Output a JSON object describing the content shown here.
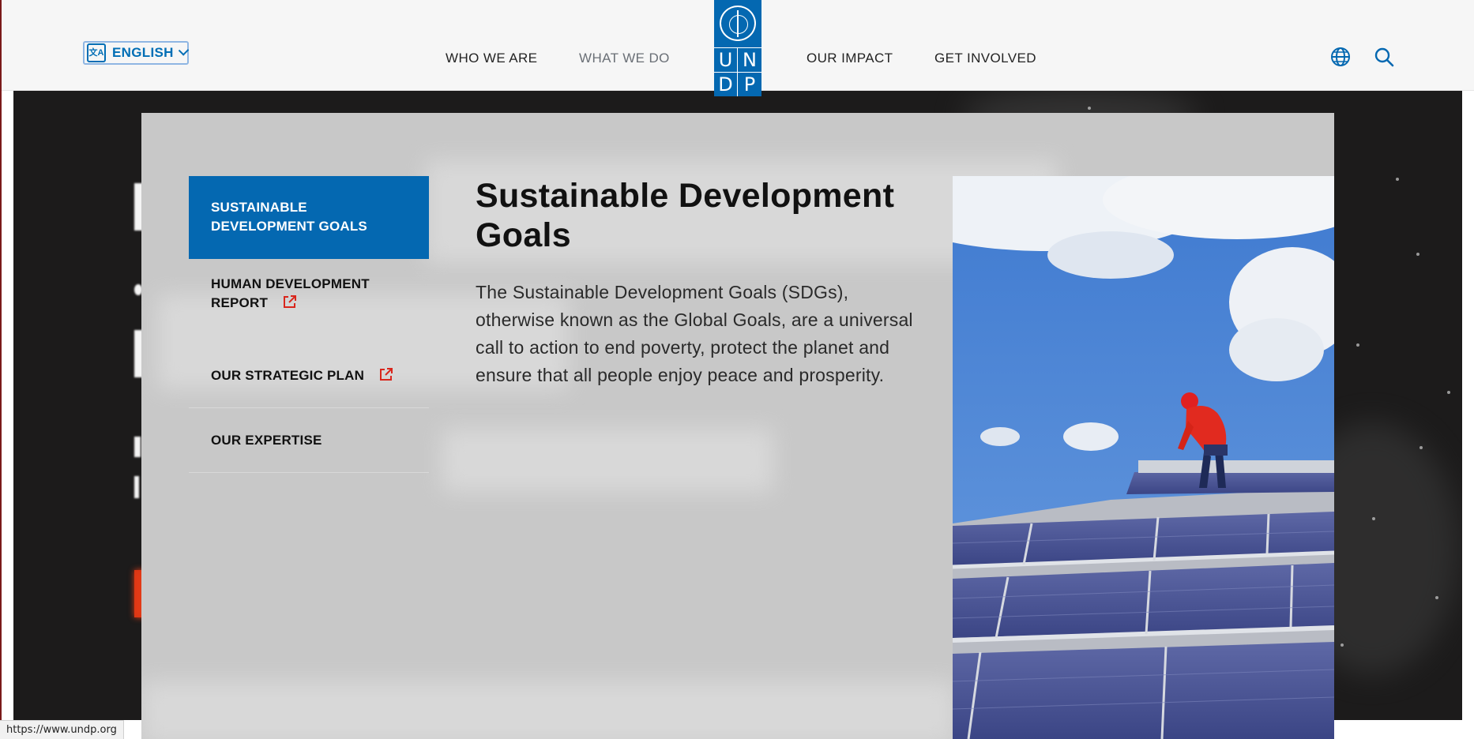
{
  "header": {
    "language": {
      "label": "ENGLISH",
      "icon": "translate-icon",
      "glyph": "文A"
    },
    "nav": [
      {
        "label": "WHO WE ARE"
      },
      {
        "label": "WHAT WE DO",
        "active": true
      },
      {
        "label": "OUR IMPACT"
      },
      {
        "label": "GET INVOLVED"
      }
    ],
    "logo": {
      "letters": [
        "U",
        "N",
        "D",
        "P"
      ]
    },
    "icons": [
      "globe-icon",
      "search-icon"
    ]
  },
  "mega_menu": {
    "items": [
      {
        "label_line1": "SUSTAINABLE",
        "label_line2": "DEVELOPMENT GOALS",
        "active": true
      },
      {
        "label_line1": "HUMAN DEVELOPMENT",
        "label_line2": "REPORT",
        "external": true
      },
      {
        "label": "OUR STRATEGIC PLAN",
        "external": true
      },
      {
        "label": "OUR EXPERTISE"
      }
    ],
    "content": {
      "title": "Sustainable Development Goals",
      "description": "The Sustainable Development Goals (SDGs), otherwise known as the Global Goals, are a universal call to action to end poverty, protect the planet and ensure that all people enjoy peace and prosperity."
    },
    "image": "worker-installing-solar-panels"
  },
  "status_bar": {
    "url": "https://www.undp.org"
  },
  "colors": {
    "brand_blue": "#0468b1",
    "accent_red": "#e23a16",
    "external_icon": "#d9261c",
    "hero_bg": "#1c1b1b",
    "menu_bg": "#c8c8c8"
  }
}
